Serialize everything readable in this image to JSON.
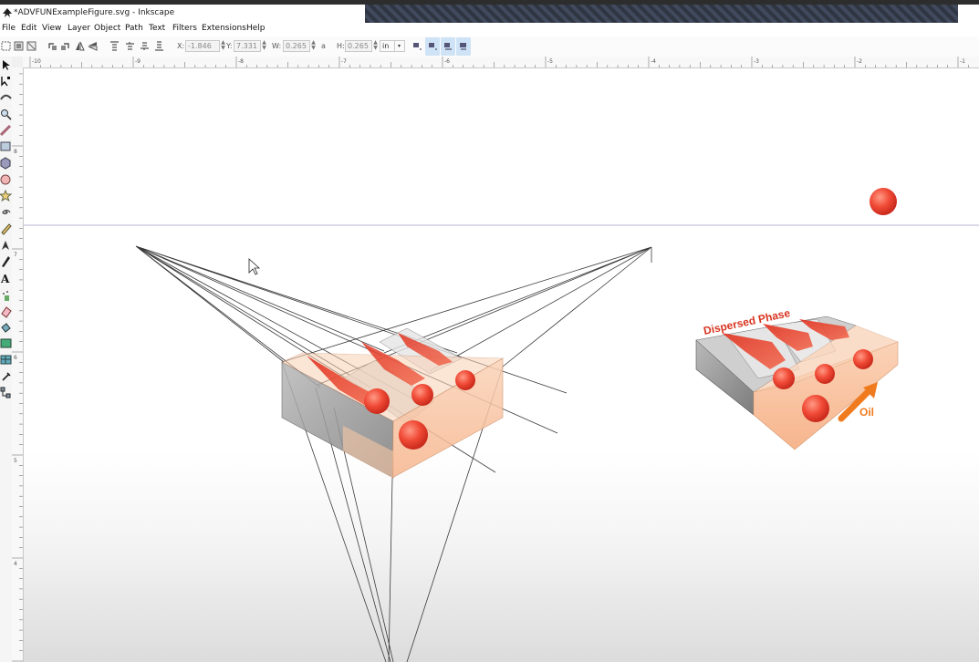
{
  "window": {
    "title": "*ADVFUNExampleFigure.svg - Inkscape"
  },
  "menu": [
    "File",
    "Edit",
    "View",
    "Layer",
    "Object",
    "Path",
    "Text",
    "Filters",
    "Extensions",
    "Help"
  ],
  "toolbar": {
    "x_label": "X:",
    "x_value": "-1.846",
    "y_label": "Y:",
    "y_value": "7.331",
    "w_label": "W:",
    "w_value": "0.265",
    "lock_glyph": "a",
    "h_label": "H:",
    "h_value": "0.265",
    "unit_value": "in"
  },
  "ruler": {
    "h_ticks": [
      "-10",
      "-9",
      "-8",
      "-7",
      "-6",
      "-5",
      "-4",
      "-3",
      "-2",
      "-1"
    ],
    "v_ticks": [
      "8",
      "7",
      "6",
      "5",
      "4",
      "3"
    ]
  },
  "figure": {
    "dispersed_label": "Dispersed Phase",
    "oil_label": "Oil"
  },
  "colors": {
    "accent_red": "#e8453c",
    "droplet": "#ee5a45",
    "oil_arrow": "#f07a1e",
    "orange_block": "#f8c4a0",
    "gray_block": "#9a9a9a"
  },
  "tools": [
    "selector-icon",
    "node-icon",
    "tweak-icon",
    "zoom-icon",
    "measure-icon",
    "rect-icon",
    "box3d-icon",
    "ellipse-icon",
    "star-icon",
    "spiral-icon",
    "pencil-icon",
    "pen-icon",
    "calligraphy-icon",
    "text-icon",
    "spray-icon",
    "eraser-icon",
    "bucket-icon",
    "gradient-icon",
    "mesh-icon",
    "dropper-icon",
    "connector-icon"
  ]
}
